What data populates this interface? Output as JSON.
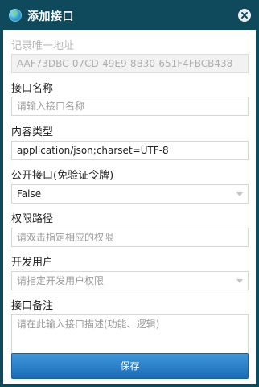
{
  "dialog": {
    "title": "添加接口",
    "icon": "globe-icon",
    "close_icon": "close-icon"
  },
  "fields": {
    "unique_address": {
      "label": "记录唯一地址",
      "value": "AAF73DBC-07CD-49E9-8B30-651F4FBCB438"
    },
    "interface_name": {
      "label": "接口名称",
      "placeholder": "请输入接口名称"
    },
    "content_type": {
      "label": "内容类型",
      "value": "application/json;charset=UTF-8"
    },
    "public_interface": {
      "label": "公开接口(免验证令牌)",
      "value": "False"
    },
    "permission_path": {
      "label": "权限路径",
      "placeholder": "请双击指定相应的权限"
    },
    "developer": {
      "label": "开发用户",
      "placeholder": "请指定开发用户权限"
    },
    "remarks": {
      "label": "接口备注",
      "placeholder": "请在此输入接口描述(功能、逻辑)"
    }
  },
  "buttons": {
    "save_label": "保存"
  },
  "colors": {
    "titlebar": "#0f4a5c",
    "save_button": "#2b82c9"
  }
}
